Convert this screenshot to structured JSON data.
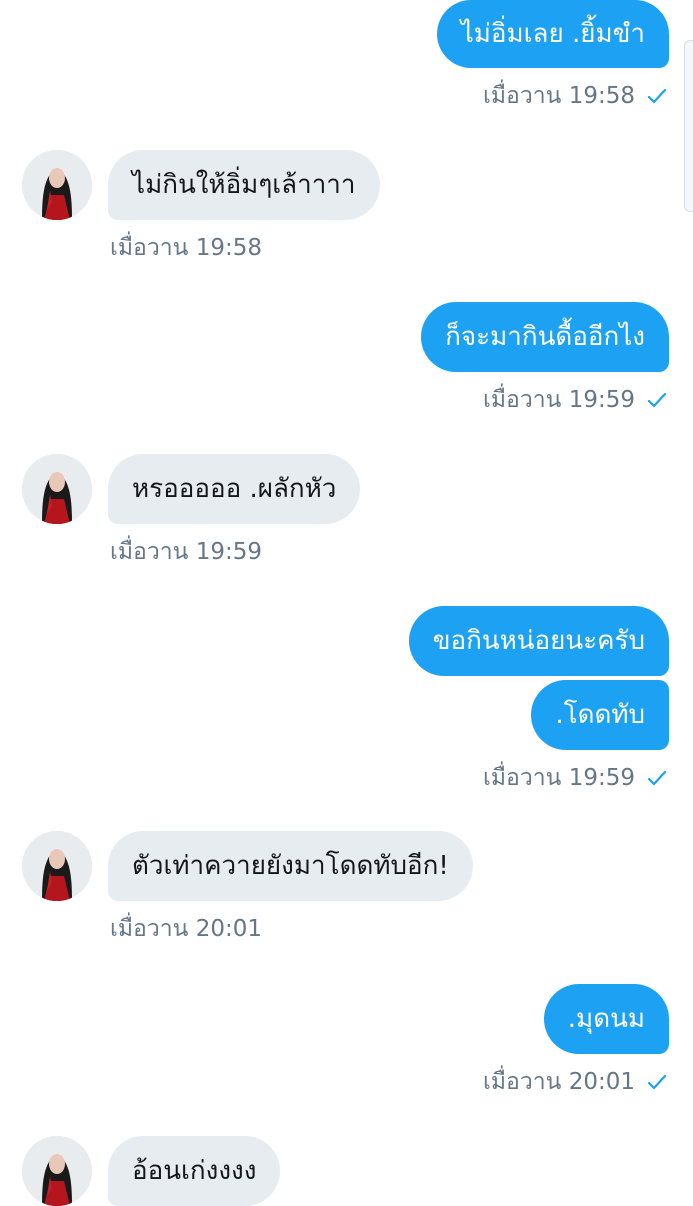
{
  "messages": [
    {
      "side": "sent",
      "text": "ไม่อิ่มเลย .ยิ้มขำ",
      "time": "เมื่อวาน 19:58"
    },
    {
      "side": "received",
      "text": "ไม่กินให้อิ่มๆเล้าาาา",
      "time": "เมื่อวาน 19:58"
    },
    {
      "side": "sent",
      "text": "ก็จะมากินดื้ออีกไง",
      "time": "เมื่อวาน 19:59"
    },
    {
      "side": "received",
      "text": "หรอออออ .ผลักหัว",
      "time": "เมื่อวาน 19:59"
    },
    {
      "side": "sent",
      "text": "ขอกินหน่อยนะครับ",
      "time": ""
    },
    {
      "side": "sent",
      "text": ".โดดทับ",
      "time": "เมื่อวาน 19:59"
    },
    {
      "side": "received",
      "text": "ตัวเท่าควายยังมาโดดทับอีก!",
      "time": "เมื่อวาน 20:01"
    },
    {
      "side": "sent",
      "text": ".มุดนม",
      "time": "เมื่อวาน 20:01"
    },
    {
      "side": "received",
      "text": "อ้อนเก่งงงง",
      "time": ""
    }
  ],
  "colors": {
    "sent_bubble": "#1da1f2",
    "received_bubble": "#e6ecf0",
    "meta_text": "#657786",
    "check": "#1da1f2"
  },
  "icons": {
    "read_receipt": "check-icon",
    "avatar": "avatar-photo"
  }
}
